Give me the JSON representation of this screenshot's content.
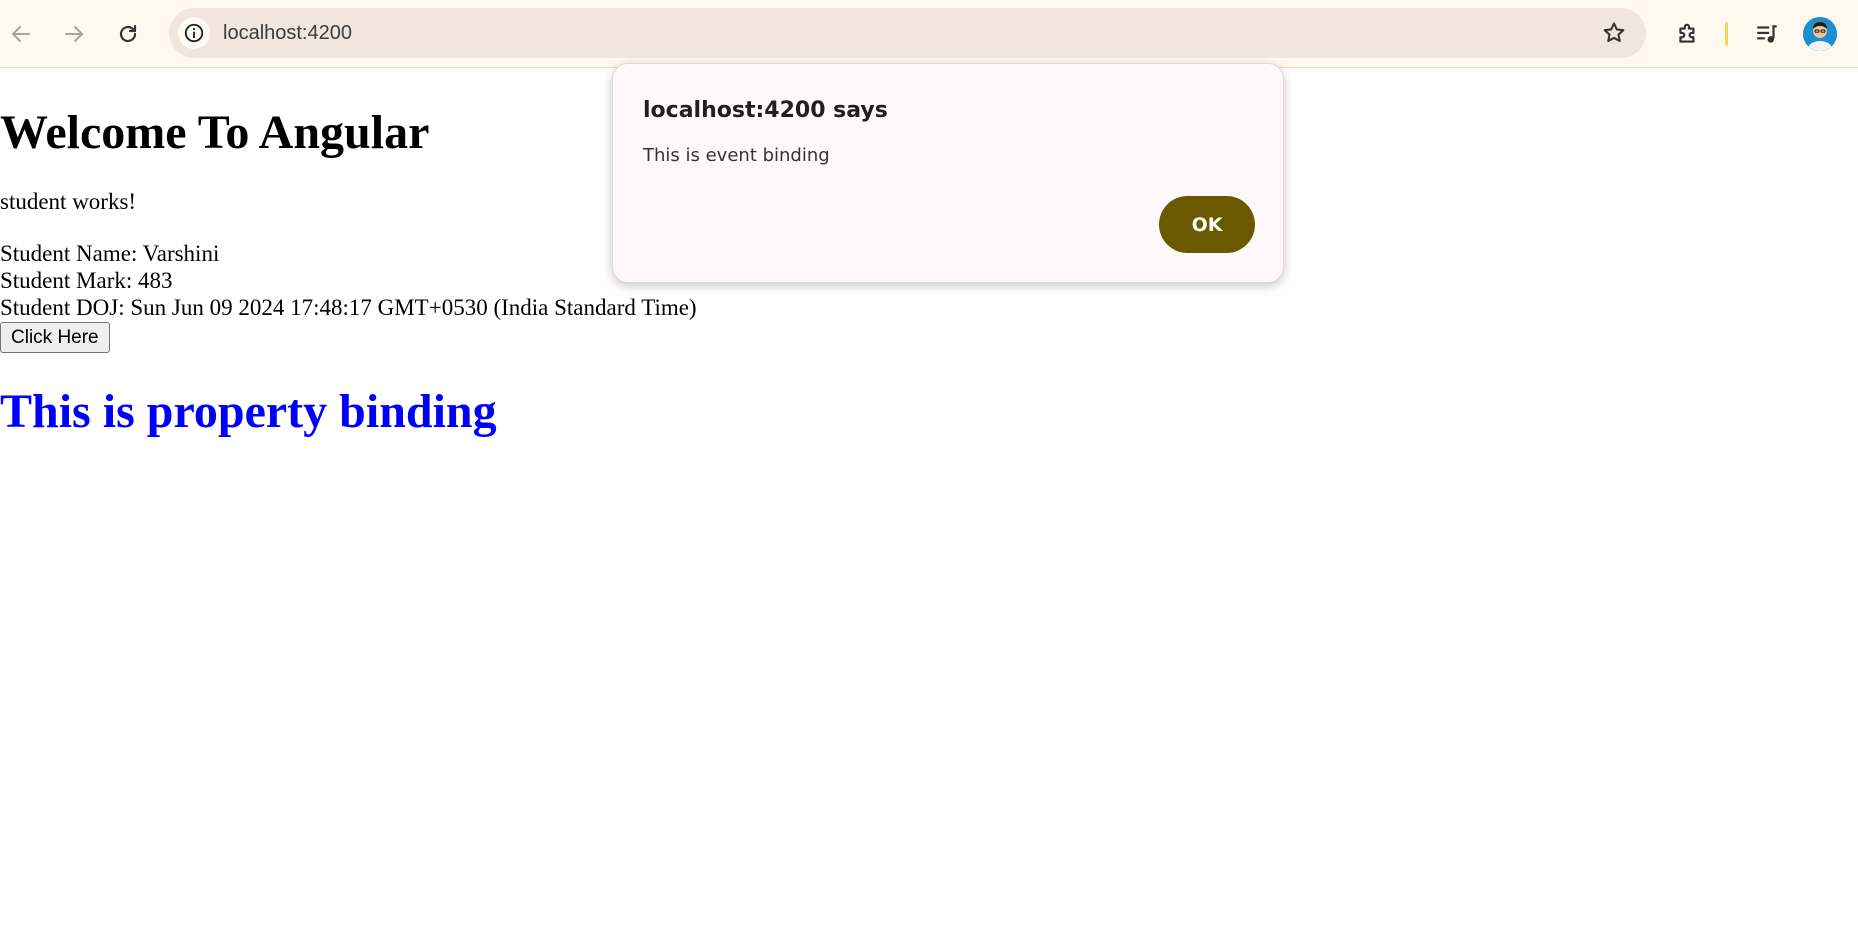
{
  "browser": {
    "url": "localhost:4200"
  },
  "page": {
    "title": "Welcome To Angular",
    "works_text": "student works!",
    "student_name_line": "Student Name: Varshini",
    "student_mark_line": "Student Mark: 483",
    "student_doj_line": "Student DOJ: Sun Jun 09 2024 17:48:17 GMT+0530 (India Standard Time)",
    "button_label": "Click Here",
    "binding_heading": "This is property binding",
    "binding_heading_color": "#0000ff"
  },
  "dialog": {
    "title": "localhost:4200 says",
    "message": "This is event binding",
    "ok_label": "OK",
    "ok_color": "#6b5900"
  },
  "icons": {
    "back": "back-arrow-icon",
    "forward": "forward-arrow-icon",
    "reload": "reload-icon",
    "site_info": "info-icon",
    "bookmark": "star-icon",
    "extensions": "puzzle-piece-icon",
    "media": "media-queue-icon",
    "profile": "avatar"
  }
}
